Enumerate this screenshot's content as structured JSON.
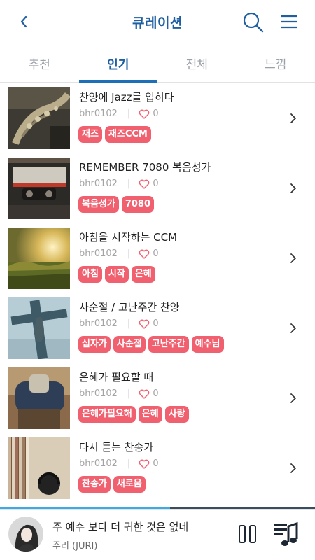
{
  "header": {
    "title": "큐레이션",
    "back_icon": "chevron-left-icon",
    "search_icon": "search-icon",
    "menu_icon": "hamburger-menu-icon",
    "accent": "#1d5fa0"
  },
  "tabs": [
    {
      "label": "추천",
      "active": false
    },
    {
      "label": "인기",
      "active": true
    },
    {
      "label": "전체",
      "active": false
    },
    {
      "label": "느낌",
      "active": false
    }
  ],
  "items": [
    {
      "title": "찬양에 Jazz를 입히다",
      "user": "bhr0102",
      "sep": "|",
      "likes": "0",
      "tags": [
        "재즈",
        "재즈CCM"
      ],
      "thumb": "saxophone"
    },
    {
      "title": "REMEMBER 7080 복음성가",
      "user": "bhr0102",
      "sep": "|",
      "likes": "0",
      "tags": [
        "복음성가",
        "7080"
      ],
      "thumb": "cassette"
    },
    {
      "title": "아침을 시작하는 CCM",
      "user": "bhr0102",
      "sep": "|",
      "likes": "0",
      "tags": [
        "아침",
        "시작",
        "은혜"
      ],
      "thumb": "meadow"
    },
    {
      "title": "사순절 / 고난주간 찬양",
      "user": "bhr0102",
      "sep": "|",
      "likes": "0",
      "tags": [
        "십자가",
        "사순절",
        "고난주간",
        "예수님"
      ],
      "thumb": "cross"
    },
    {
      "title": "은혜가 필요할 때",
      "user": "bhr0102",
      "sep": "|",
      "likes": "0",
      "tags": [
        "은혜가필요해",
        "은혜",
        "사랑"
      ],
      "thumb": "prayer"
    },
    {
      "title": "다시 듣는 찬송가",
      "user": "bhr0102",
      "sep": "|",
      "likes": "0",
      "tags": [
        "찬송가",
        "새로움"
      ],
      "thumb": "records"
    }
  ],
  "tag_color": "#f0606f",
  "player": {
    "song": "주 예수 보다 더 귀한 것은 없네",
    "artist": "주리 (JURI)",
    "progress": 0.54,
    "pause_icon": "pause-icon",
    "playlist_icon": "playlist-icon"
  }
}
